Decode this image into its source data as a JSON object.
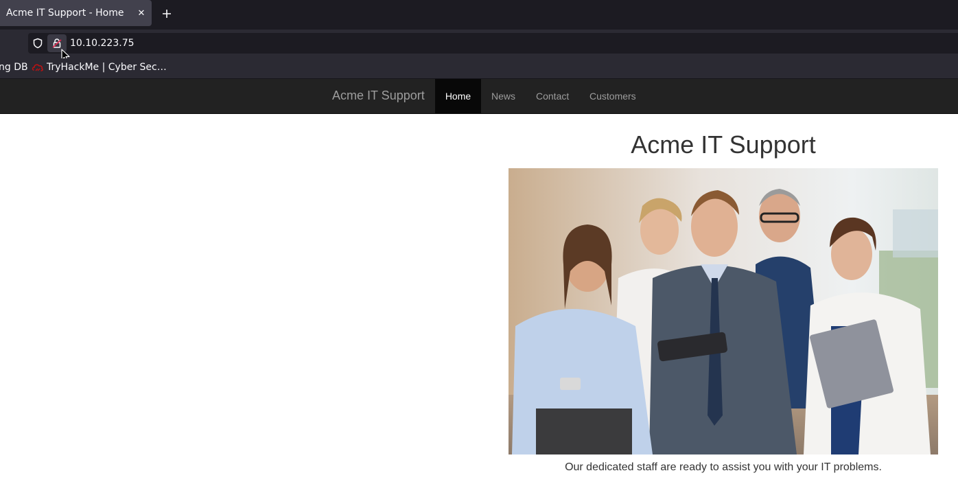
{
  "browser": {
    "tab": {
      "title": "Acme IT Support - Home",
      "close_glyph": "✕"
    },
    "new_tab_icon": "plus-icon",
    "url": "10.10.223.75",
    "bookmarks": [
      {
        "label": "ng DB"
      },
      {
        "label": "TryHackMe | Cyber Sec…",
        "icon": "tryhackme-logo-icon"
      }
    ]
  },
  "navbar": {
    "brand": "Acme IT Support",
    "links": [
      {
        "label": "Home",
        "active": true
      },
      {
        "label": "News"
      },
      {
        "label": "Contact"
      },
      {
        "label": "Customers"
      }
    ]
  },
  "content": {
    "title": "Acme IT Support",
    "caption": "Our dedicated staff are ready to assist you with your IT problems."
  },
  "colors": {
    "chrome_dark": "#1c1b22",
    "chrome": "#2b2a33",
    "tab_active": "#42414d",
    "navbar_bg": "#222222",
    "navbar_active": "#080808",
    "navbar_text": "#9d9d9d",
    "tryhackme_red": "#c11111"
  }
}
